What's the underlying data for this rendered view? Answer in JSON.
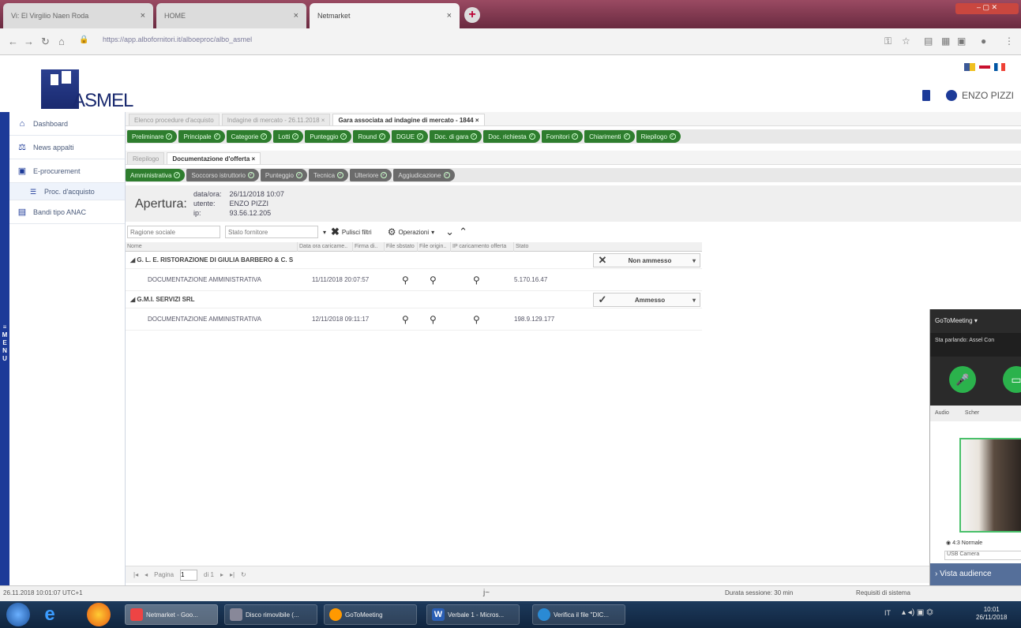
{
  "browser": {
    "tabs": [
      {
        "label": "Vi: El Virgilio Naen Roda"
      },
      {
        "label": "HOME"
      },
      {
        "label": "Netmarket"
      }
    ],
    "new_tab": "+",
    "url": "https://app.albofornitori.it/alboeproc/albo_asmel"
  },
  "header": {
    "logo_text": "ASMEL",
    "user_name": "ENZO PIZZI"
  },
  "sidebar": {
    "menu_label": "MENU",
    "items": [
      {
        "label": "Dashboard"
      },
      {
        "label": "News appalti"
      },
      {
        "label": "E-procurement"
      },
      {
        "label": "Proc. d'acquisto"
      },
      {
        "label": "Bandi tipo ANAC"
      }
    ]
  },
  "tabs1": [
    {
      "label": "Elenco procedure d'acquisto"
    },
    {
      "label": "Indagine di mercato - 26.11.2018"
    },
    {
      "label": "Gara associata ad indagine di mercato - 1844"
    }
  ],
  "steps1": [
    "Preliminare",
    "Principale",
    "Categorie",
    "Lotti",
    "Punteggio",
    "Round",
    "DGUE",
    "Doc. di gara",
    "Doc. richiesta",
    "Fornitori",
    "Chiarimenti",
    "Riepilogo"
  ],
  "tabs2": [
    {
      "label": "Riepilogo"
    },
    {
      "label": "Documentazione d'offerta"
    }
  ],
  "steps2": [
    "Amministrativa",
    "Soccorso istruttorio",
    "Punteggio",
    "Tecnica",
    "Ulteriore",
    "Aggiudicazione"
  ],
  "apertura": {
    "title": "Apertura:",
    "data_label": "data/ora:",
    "data_value": "26/11/2018 10:07",
    "utente_label": "utente:",
    "utente_value": "ENZO PIZZI",
    "ip_label": "ip:",
    "ip_value": "93.56.12.205"
  },
  "filters": {
    "ragione_placeholder": "Ragione sociale",
    "stato_placeholder": "Stato fornitore",
    "pulisci": "Pulisci filtri",
    "operazioni": "Operazioni"
  },
  "grid": {
    "columns": [
      "Nome",
      "Data ora caricame..",
      "Firma di..",
      "File sbstato",
      "File origin..",
      "IP caricamento offerta",
      "Stato"
    ],
    "groups": [
      {
        "name": "G. L. E. RISTORAZIONE DI GIULIA BARBERO & C. S",
        "status": "Non ammesso",
        "status_mark": "✕",
        "row": {
          "doc": "DOCUMENTAZIONE AMMINISTRATIVA",
          "date": "11/11/2018 20:07:57",
          "ip": "5.170.16.47"
        }
      },
      {
        "name": "G.M.I. SERVIZI SRL",
        "status": "Ammesso",
        "status_mark": "✓",
        "row": {
          "doc": "DOCUMENTAZIONE AMMINISTRATIVA",
          "date": "12/11/2018 09:11:17",
          "ip": "198.9.129.177"
        }
      }
    ]
  },
  "pager": {
    "page_label": "Pagina",
    "page_value": "1",
    "of_label": "di 1"
  },
  "statusbar": {
    "left": "26.11.2018 10:01:07 UTC+1",
    "center": "j~",
    "duration": "Durata sessione: 30 min",
    "right": "Requisiti di sistema"
  },
  "gtm": {
    "title": "GoToMeeting",
    "speaking": "Sta parlando: Assel Con",
    "audio": "Audio",
    "screen": "Scher",
    "option": "4:3 Normale",
    "usb": "USB Camera",
    "footer": "Vista audience"
  },
  "taskbar": {
    "items": [
      "Netmarket - Goo...",
      "Disco rimovibile (...",
      "GoToMeeting",
      "Verbale 1 - Micros...",
      "Verifica il file \"DIC..."
    ],
    "lang": "IT",
    "time": "10:01",
    "date": "26/11/2018"
  },
  "colors": {
    "brand": "#1c3a98",
    "step_green": "#2e7d2e",
    "step_grey": "#6b6b6b",
    "accent_green": "#2bb24c"
  }
}
